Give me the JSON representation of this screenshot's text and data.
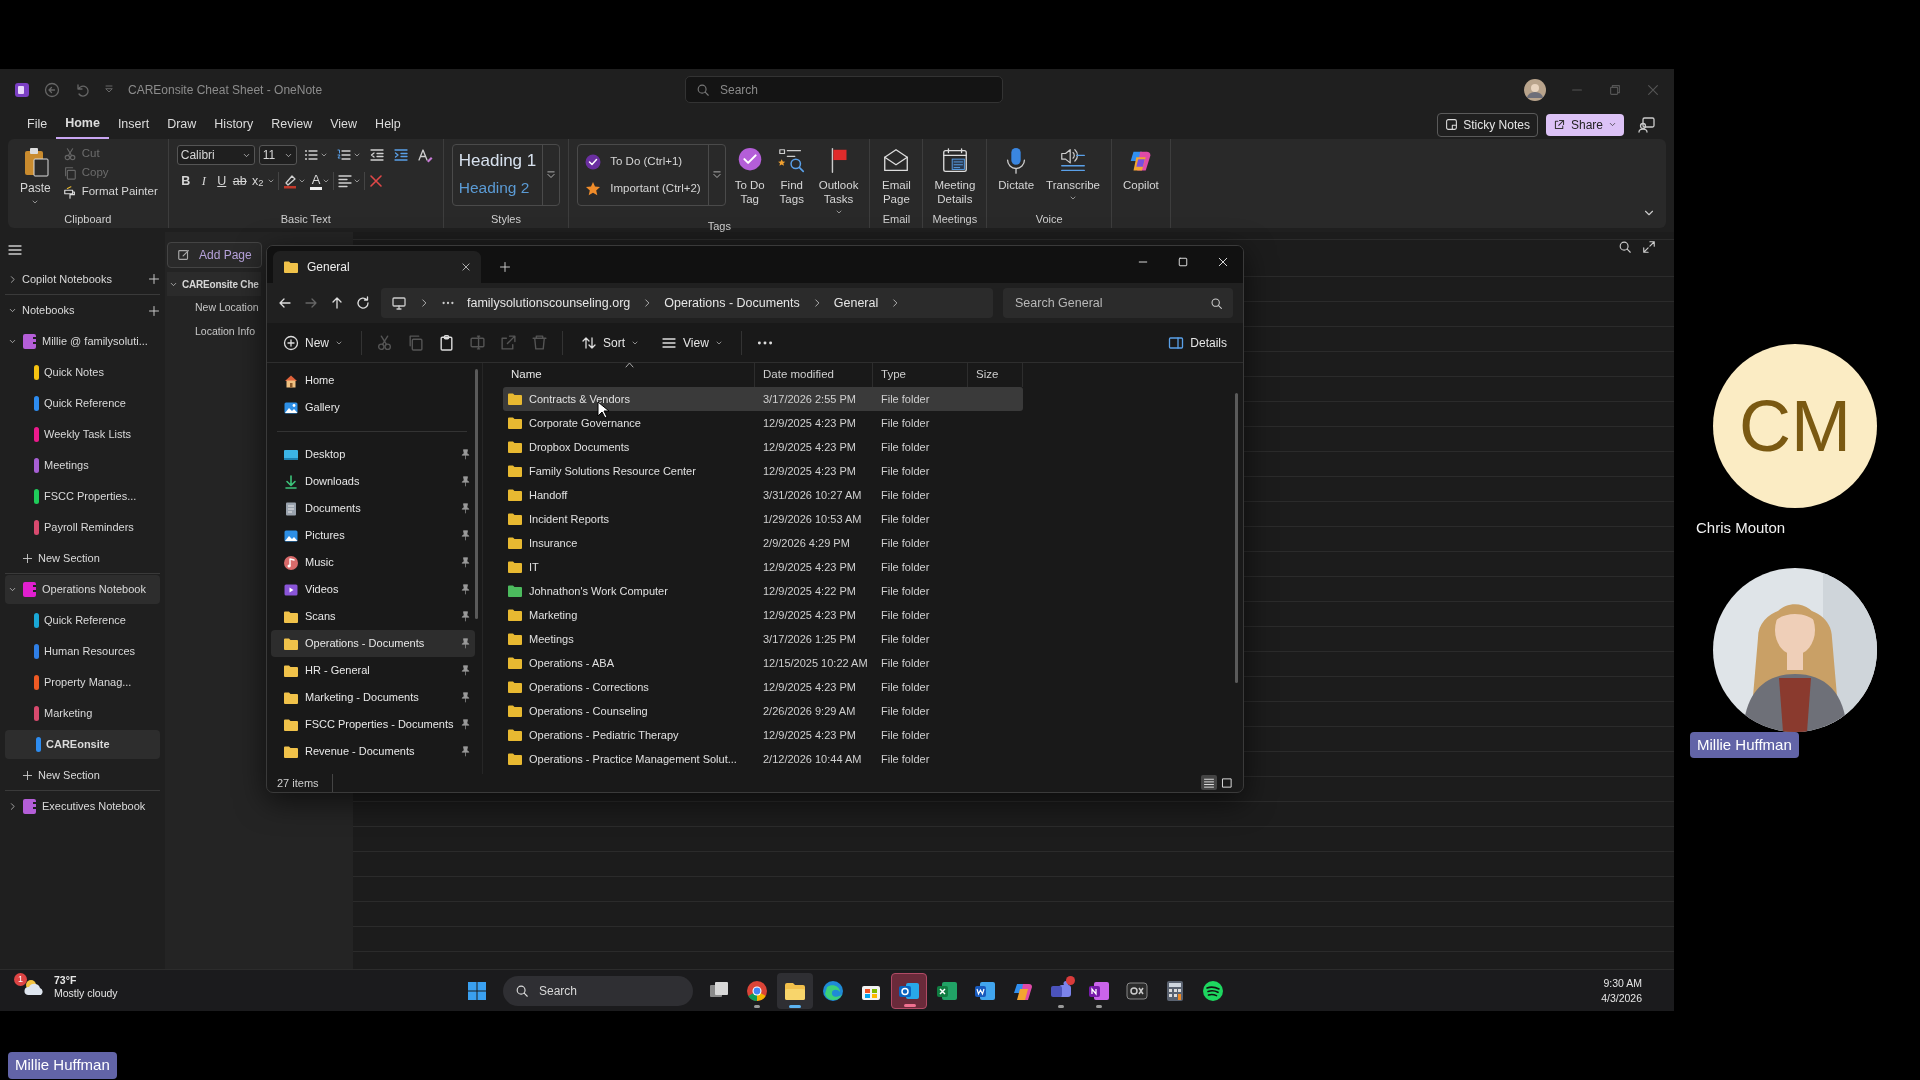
{
  "onenote": {
    "title": "CAREonsite Cheat Sheet - OneNote",
    "search": {
      "placeholder": "Search"
    },
    "menu_tabs": [
      {
        "label": "File",
        "selected": false
      },
      {
        "label": "Home",
        "selected": true
      },
      {
        "label": "Insert",
        "selected": false
      },
      {
        "label": "Draw",
        "selected": false
      },
      {
        "label": "History",
        "selected": false
      },
      {
        "label": "Review",
        "selected": false
      },
      {
        "label": "View",
        "selected": false
      },
      {
        "label": "Help",
        "selected": false
      }
    ],
    "header_buttons": [
      {
        "label": "Sticky Notes",
        "kind": "outline"
      },
      {
        "label": "Share",
        "kind": "accent"
      }
    ],
    "ribbon": {
      "groups": [
        {
          "kind": "clipboard",
          "label": "Clipboard",
          "paste": "Paste",
          "items": [
            {
              "label": "Cut",
              "disabled": true
            },
            {
              "label": "Copy",
              "disabled": true
            },
            {
              "label": "Format Painter",
              "disabled": false
            }
          ]
        },
        {
          "kind": "basic_text",
          "label": "Basic Text",
          "font": "Calibri",
          "size": "11",
          "format_buttons": [
            "B",
            "I",
            "U",
            "ab",
            "x$_{2}$"
          ],
          "font_color": "A"
        },
        {
          "kind": "styles",
          "label": "Styles",
          "items": [
            "Heading 1",
            "Heading 2"
          ]
        },
        {
          "kind": "tags",
          "label": "Tags",
          "items": [
            "To Do (Ctrl+1)",
            "Important (Ctrl+2)"
          ],
          "buttons": [
            {
              "lines": [
                "To Do",
                "Tag"
              ],
              "dropdown": false
            },
            {
              "lines": [
                "Find",
                "Tags"
              ],
              "dropdown": false
            },
            {
              "lines": [
                "Outlook",
                "Tasks"
              ],
              "dropdown": true
            }
          ]
        },
        {
          "kind": "buttons",
          "label": "Email",
          "buttons": [
            {
              "lines": [
                "Email",
                "Page"
              ],
              "dropdown": false
            }
          ]
        },
        {
          "kind": "buttons",
          "label": "Meetings",
          "buttons": [
            {
              "lines": [
                "Meeting",
                "Details"
              ],
              "dropdown": false
            }
          ]
        },
        {
          "kind": "buttons",
          "label": "Voice",
          "buttons": [
            {
              "lines": [
                "Dictate"
              ],
              "dropdown": false
            },
            {
              "lines": [
                "Transcribe"
              ],
              "dropdown": true
            }
          ]
        },
        {
          "kind": "buttons",
          "buttons": [
            {
              "lines": [
                "Copilot"
              ],
              "dropdown": false
            }
          ]
        }
      ]
    },
    "nav": {
      "groups": [
        {
          "label": "Copilot Notebooks",
          "expanded": false
        },
        {
          "label": "Notebooks",
          "expanded": true
        }
      ],
      "notebooks": [
        {
          "name": "Millie @ familysoluti...",
          "color": "#b45ed8",
          "expanded": true,
          "selected": false,
          "sections": [
            {
              "name": "Quick Notes",
              "color": "#f5c211",
              "selected": false
            },
            {
              "name": "Quick Reference",
              "color": "#2d8cf0",
              "selected": false
            },
            {
              "name": "Weekly Task Lists",
              "color": "#ec1a8c",
              "selected": false
            },
            {
              "name": "Meetings",
              "color": "#a65fd3",
              "selected": false
            },
            {
              "name": "FSCC Properties...",
              "color": "#1fcc5a",
              "selected": false
            },
            {
              "name": "Payroll Reminders",
              "color": "#d84a6e",
              "selected": false
            }
          ],
          "new_section": "New Section"
        },
        {
          "name": "Operations Notebook",
          "color": "#e11fd0",
          "expanded": true,
          "selected": true,
          "sections": [
            {
              "name": "Quick Reference",
              "color": "#1aa7d6",
              "selected": false
            },
            {
              "name": "Human Resources",
              "color": "#2f7fe6",
              "selected": false
            },
            {
              "name": "Property Manag...",
              "color": "#ee5a24",
              "selected": false
            },
            {
              "name": "Marketing",
              "color": "#d84a6e",
              "selected": false
            },
            {
              "name": "CAREonsite",
              "color": "#2d8cf0",
              "selected": true
            }
          ],
          "new_section": "New Section"
        },
        {
          "name": "Executives Notebook",
          "color": "#b45ed8",
          "expanded": false,
          "selected": false
        }
      ]
    },
    "pages": {
      "add_page": "Add Page",
      "items": [
        {
          "title": "CAREonsite Che",
          "expanded": true,
          "children": [
            {
              "title": "New Location"
            },
            {
              "title": "Location Info"
            }
          ]
        }
      ]
    }
  },
  "explorer": {
    "tabs": [
      {
        "label": "General",
        "selected": true
      }
    ],
    "breadcrumb": [
      "familysolutionscounseling.org",
      "Operations - Documents",
      "General"
    ],
    "search": {
      "placeholder": "Search General"
    },
    "toolbar": {
      "new": "New",
      "actions": [
        {
          "kind": "cut",
          "disabled": true
        },
        {
          "kind": "copy",
          "disabled": true
        },
        {
          "kind": "paste",
          "disabled": false
        },
        {
          "kind": "rename",
          "disabled": true
        },
        {
          "kind": "share",
          "disabled": true
        },
        {
          "kind": "delete",
          "disabled": true
        }
      ],
      "sort": "Sort",
      "view": "View",
      "details": "Details"
    },
    "nav_top": [
      {
        "label": "Home",
        "kind": "home",
        "pinned": false,
        "selected": false
      },
      {
        "label": "Gallery",
        "kind": "gallery",
        "pinned": false,
        "selected": false
      }
    ],
    "nav_quick": [
      {
        "label": "Desktop",
        "kind": "desktop",
        "pinned": true,
        "selected": false
      },
      {
        "label": "Downloads",
        "kind": "downloads",
        "pinned": true,
        "selected": false
      },
      {
        "label": "Documents",
        "kind": "documents",
        "pinned": true,
        "selected": false
      },
      {
        "label": "Pictures",
        "kind": "pictures",
        "pinned": true,
        "selected": false
      },
      {
        "label": "Music",
        "kind": "music",
        "pinned": true,
        "selected": false
      },
      {
        "label": "Videos",
        "kind": "videos",
        "pinned": true,
        "selected": false
      },
      {
        "label": "Scans",
        "kind": "folder",
        "pinned": true,
        "selected": false
      },
      {
        "label": "Operations - Documents",
        "kind": "folder",
        "pinned": true,
        "selected": true
      },
      {
        "label": "HR - General",
        "kind": "folder",
        "pinned": true,
        "selected": false
      },
      {
        "label": "Marketing - Documents",
        "kind": "folder",
        "pinned": true,
        "selected": false
      },
      {
        "label": "FSCC Properties - Documents",
        "kind": "folder",
        "pinned": true,
        "selected": false
      },
      {
        "label": "Revenue - Documents",
        "kind": "folder",
        "pinned": true,
        "selected": false
      }
    ],
    "columns": [
      {
        "label": "Name",
        "sorted": true
      },
      {
        "label": "Date modified",
        "sorted": false
      },
      {
        "label": "Type",
        "sorted": false
      },
      {
        "label": "Size",
        "sorted": false
      }
    ],
    "rows": [
      {
        "name": "Contracts & Vendors",
        "date": "3/17/2026 2:55 PM",
        "type": "File folder",
        "color": "#e8b931",
        "selected": true
      },
      {
        "name": "Corporate Governance",
        "date": "12/9/2025 4:23 PM",
        "type": "File folder",
        "color": "#e8b931",
        "selected": false
      },
      {
        "name": "Dropbox Documents",
        "date": "12/9/2025 4:23 PM",
        "type": "File folder",
        "color": "#e8b931",
        "selected": false
      },
      {
        "name": "Family Solutions Resource Center",
        "date": "12/9/2025 4:23 PM",
        "type": "File folder",
        "color": "#e8b931",
        "selected": false
      },
      {
        "name": "Handoff",
        "date": "3/31/2026 10:27 AM",
        "type": "File folder",
        "color": "#e8b931",
        "selected": false
      },
      {
        "name": "Incident Reports",
        "date": "1/29/2026 10:53 AM",
        "type": "File folder",
        "color": "#e8b931",
        "selected": false
      },
      {
        "name": "Insurance",
        "date": "2/9/2026 4:29 PM",
        "type": "File folder",
        "color": "#e8b931",
        "selected": false
      },
      {
        "name": "IT",
        "date": "12/9/2025 4:23 PM",
        "type": "File folder",
        "color": "#e8b931",
        "selected": false
      },
      {
        "name": "Johnathon's Work Computer",
        "date": "12/9/2025 4:22 PM",
        "type": "File folder",
        "color": "#4cbb5e",
        "selected": false
      },
      {
        "name": "Marketing",
        "date": "12/9/2025 4:23 PM",
        "type": "File folder",
        "color": "#e8b931",
        "selected": false
      },
      {
        "name": "Meetings",
        "date": "3/17/2026 1:25 PM",
        "type": "File folder",
        "color": "#e8b931",
        "selected": false
      },
      {
        "name": "Operations - ABA",
        "date": "12/15/2025 10:22 AM",
        "type": "File folder",
        "color": "#e8b931",
        "selected": false
      },
      {
        "name": "Operations - Corrections",
        "date": "12/9/2025 4:23 PM",
        "type": "File folder",
        "color": "#e8b931",
        "selected": false
      },
      {
        "name": "Operations - Counseling",
        "date": "2/26/2026 9:29 AM",
        "type": "File folder",
        "color": "#e8b931",
        "selected": false
      },
      {
        "name": "Operations - Pediatric Therapy",
        "date": "12/9/2025 4:23 PM",
        "type": "File folder",
        "color": "#e8b931",
        "selected": false
      },
      {
        "name": "Operations - Practice Management Solut...",
        "date": "2/12/2026 10:44 AM",
        "type": "File folder",
        "color": "#e8b931",
        "selected": false
      }
    ],
    "status": "27 items",
    "view_toggles": [
      {
        "selected": true
      },
      {
        "selected": false
      }
    ]
  },
  "taskbar": {
    "weather": {
      "temp": "73°F",
      "desc": "Mostly cloudy",
      "badge": "1"
    },
    "search": {
      "placeholder": "Search"
    },
    "apps": [
      {
        "kind": "task_view",
        "running": false,
        "active": false,
        "attention": false,
        "notification": false
      },
      {
        "kind": "chrome",
        "running": true,
        "active": false,
        "attention": false,
        "notification": false
      },
      {
        "kind": "files",
        "running": true,
        "active": true,
        "attention": false,
        "notification": false
      },
      {
        "kind": "edge",
        "running": false,
        "active": false,
        "attention": false,
        "notification": false
      },
      {
        "kind": "store",
        "running": false,
        "active": false,
        "attention": false,
        "notification": false
      },
      {
        "kind": "mail",
        "running": true,
        "active": false,
        "attention": true,
        "notification": false
      },
      {
        "kind": "sheet",
        "running": false,
        "active": false,
        "attention": false,
        "notification": false
      },
      {
        "kind": "doc",
        "running": false,
        "active": false,
        "attention": false,
        "notification": false
      },
      {
        "kind": "assistant",
        "running": false,
        "active": false,
        "attention": false,
        "notification": false
      },
      {
        "kind": "chat",
        "running": true,
        "active": false,
        "attention": false,
        "notification": true
      },
      {
        "kind": "notebook",
        "running": true,
        "active": false,
        "attention": false,
        "notification": false
      },
      {
        "kind": "app",
        "running": false,
        "active": false,
        "attention": false,
        "notification": false
      },
      {
        "kind": "calculator",
        "running": false,
        "active": false,
        "attention": false,
        "notification": false
      },
      {
        "kind": "music",
        "running": false,
        "active": false,
        "attention": false,
        "notification": false
      }
    ],
    "time": "9:30 AM",
    "date": "4/3/2026"
  },
  "participants": [
    {
      "kind": "initials",
      "initials": "CM",
      "name": "Chris Mouton"
    },
    {
      "name": "Millie Huffman"
    }
  ],
  "presenter": {
    "name": "Millie Huffman"
  }
}
